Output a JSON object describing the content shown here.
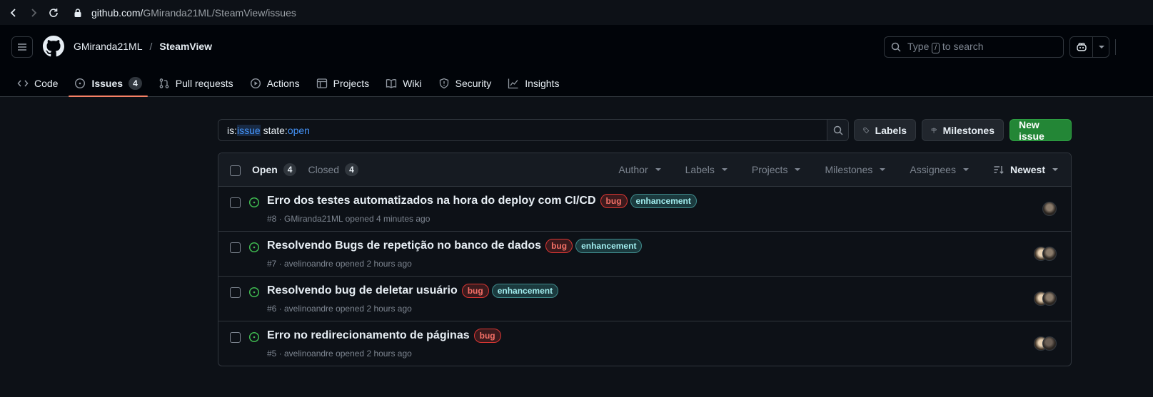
{
  "browser": {
    "url_host": "github.com/",
    "url_path": "GMiranda21ML/SteamView/issues"
  },
  "header": {
    "owner": "GMiranda21ML",
    "separator": "/",
    "repo": "SteamView",
    "search_pre": "Type",
    "search_key": "/",
    "search_post": "to search"
  },
  "tabs": [
    {
      "label": "Code",
      "icon": "code-icon"
    },
    {
      "label": "Issues",
      "icon": "issue-opened-icon",
      "count": "4",
      "active": true
    },
    {
      "label": "Pull requests",
      "icon": "git-pull-request-icon"
    },
    {
      "label": "Actions",
      "icon": "play-icon"
    },
    {
      "label": "Projects",
      "icon": "table-icon"
    },
    {
      "label": "Wiki",
      "icon": "book-icon"
    },
    {
      "label": "Security",
      "icon": "shield-icon"
    },
    {
      "label": "Insights",
      "icon": "graph-icon"
    }
  ],
  "filter": {
    "is_prefix": "is:",
    "is_value": "issue",
    "state_prefix": " state:",
    "state_value": "open"
  },
  "buttons": {
    "labels": "Labels",
    "milestones": "Milestones",
    "new_issue": "New issue"
  },
  "list_header": {
    "open_label": "Open",
    "open_count": "4",
    "closed_label": "Closed",
    "closed_count": "4",
    "filters": [
      "Author",
      "Labels",
      "Projects",
      "Milestones",
      "Assignees"
    ],
    "sort": "Newest"
  },
  "issues": [
    {
      "title": "Erro dos testes automatizados na hora do deploy com CI/CD",
      "labels": [
        "bug",
        "enhancement"
      ],
      "meta": "#8 · GMiranda21ML opened 4 minutes ago"
    },
    {
      "title": "Resolvendo Bugs de repetição no banco de dados",
      "labels": [
        "bug",
        "enhancement"
      ],
      "meta": "#7 · avelinoandre opened 2 hours ago"
    },
    {
      "title": "Resolvendo bug de deletar usuário",
      "labels": [
        "bug",
        "enhancement"
      ],
      "meta": "#6 · avelinoandre opened 2 hours ago"
    },
    {
      "title": "Erro no redirecionamento de páginas",
      "labels": [
        "bug"
      ],
      "meta": "#5 · avelinoandre opened 2 hours ago"
    }
  ],
  "colors": {
    "accent_tab": "#f78166",
    "open_green": "#3fb950",
    "new_issue_bg": "#238636"
  }
}
